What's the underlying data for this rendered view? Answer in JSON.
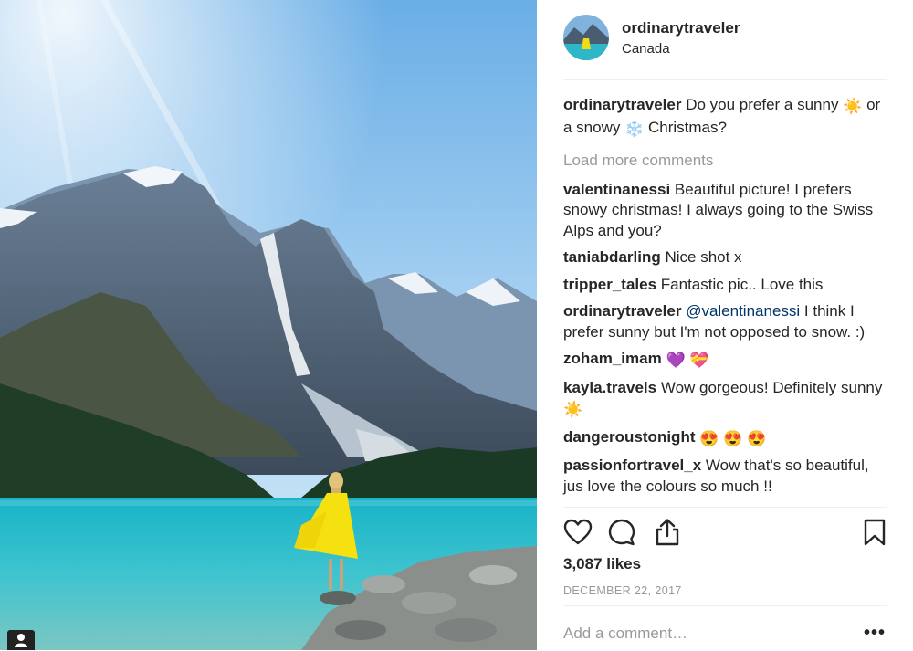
{
  "post": {
    "username": "ordinarytraveler",
    "location": "Canada",
    "caption": {
      "user": "ordinarytraveler",
      "text_1": "Do you prefer a sunny ",
      "text_2": "or a snowy ",
      "text_3": " Christmas?",
      "emoji_1": "☀️",
      "emoji_2": "❄️"
    },
    "load_more": "Load more comments",
    "comments": [
      {
        "user": "valentinanessi",
        "text": "Beautiful picture! I prefers snowy christmas! I always going to the Swiss Alps and you?"
      },
      {
        "user": "taniabdarling",
        "text": "Nice shot x"
      },
      {
        "user": "tripper_tales",
        "text": "Fantastic pic.. Love this"
      },
      {
        "user": "ordinarytraveler",
        "mention": "@valentinanessi",
        "text": " I think I prefer sunny but I'm not opposed to snow. :)"
      },
      {
        "user": "zoham_imam",
        "text": "",
        "emoji": "💜 💝"
      },
      {
        "user": "kayla.travels",
        "text": "Wow gorgeous! Definitely sunny ",
        "emoji": "☀️"
      },
      {
        "user": "dangeroustonight",
        "text": "",
        "emoji": "😍 😍 😍"
      },
      {
        "user": "passionfortravel_x",
        "text": "Wow that's so beautiful, jus love the colours so much !!"
      }
    ],
    "likes": "3,087 likes",
    "date": "DECEMBER 22, 2017",
    "add_comment_placeholder": "Add a comment…",
    "more_label": "•••"
  },
  "icons": {
    "like": "heart-icon",
    "comment": "comment-bubble-icon",
    "share": "share-icon",
    "save": "bookmark-icon",
    "user_tag": "user-tag-icon"
  },
  "colors": {
    "text": "#262626",
    "muted": "#999999",
    "mention": "#003569",
    "divider": "#efefef"
  }
}
